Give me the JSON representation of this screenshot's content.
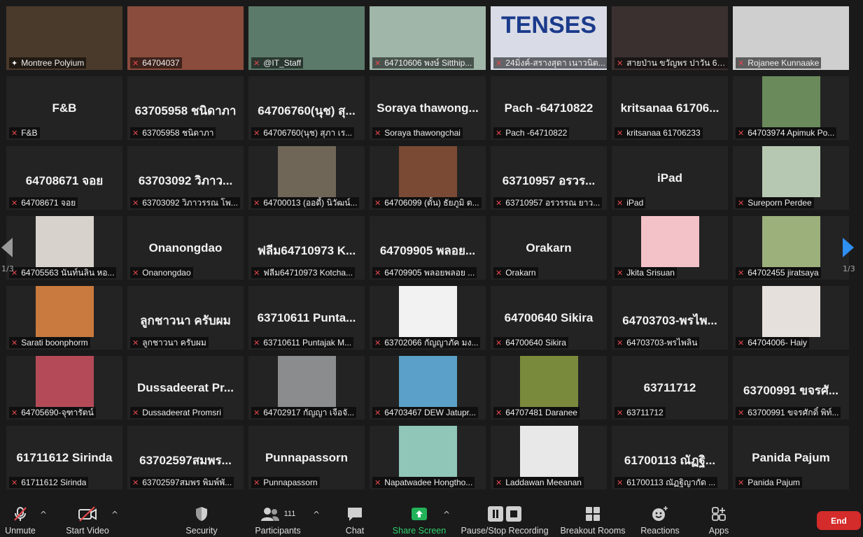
{
  "pagination": {
    "left": "1/3",
    "right": "1/3"
  },
  "tiles": [
    {
      "label": "Montree Polyium",
      "video": true,
      "pin": true,
      "active": true,
      "bg": "#4a3a2c"
    },
    {
      "label": "64704037",
      "video": true,
      "bg": "#8a4c3c"
    },
    {
      "label": "@IT_Staff",
      "video": true,
      "thumb": true,
      "bg": "#5c7a6a"
    },
    {
      "label": "64710606 พงษ์ Sitthip...",
      "video": true,
      "bg": "#9fb6a8"
    },
    {
      "label": "24มิ่งค์-สรางสุดา เนาวนิต...",
      "video": true,
      "bg": "#d9dce6",
      "text_overlay": "TENSES"
    },
    {
      "label": "สายป่าน ขวัญพร ปาวัน 64...",
      "video": true,
      "bg": "#3a3030"
    },
    {
      "label": "Rojanee Kunnaake",
      "video": true,
      "bg": "#cfcfcf"
    },
    {
      "big": "F&B",
      "label": "F&B"
    },
    {
      "big": "63705958 ชนิดาภา",
      "label": "63705958 ชนิดาภา"
    },
    {
      "big": "64706760(นุช) สุ...",
      "label": "64706760(นุช) สุภา เร..."
    },
    {
      "big": "Soraya thawong...",
      "label": "Soraya thawongchai"
    },
    {
      "big": "Pach -64710822",
      "label": "Pach -64710822"
    },
    {
      "big": "kritsanaa 61706...",
      "label": "kritsanaa 61706233"
    },
    {
      "label": "64703974 Apimuk Po...",
      "thumb": true,
      "bg": "#6a8a5c"
    },
    {
      "big": "64708671 จอย",
      "label": "64708671 จอย"
    },
    {
      "big": "63703092 วิภาว...",
      "label": "63703092 วิภาวรรณ โพ..."
    },
    {
      "label": "64700013 (ออดี้) นิวัฒน์...",
      "thumb": true,
      "bg": "#6f6658"
    },
    {
      "label": "64706099 (ตั้น) ธัยภูมิ ต...",
      "thumb": true,
      "bg": "#7a4a34"
    },
    {
      "big": "63710957 อรวร...",
      "label": "63710957 อรวรรณ ยาว..."
    },
    {
      "big": "iPad",
      "label": "iPad"
    },
    {
      "label": "Sureporn Perdee",
      "thumb": true,
      "bg": "#b7c8b2"
    },
    {
      "label": "64705563 นันท์นลิน หอ...",
      "thumb": true,
      "bg": "#d7d2cc"
    },
    {
      "big": "Onanongdao",
      "label": "Onanongdao"
    },
    {
      "big": "ฟลีม64710973 K...",
      "label": "ฟลีม64710973 Kotcha..."
    },
    {
      "big": "64709905 พลอย...",
      "label": "64709905 พลอยพลอย ..."
    },
    {
      "big": "Orakarn",
      "label": "Orakarn"
    },
    {
      "label": "Jkita Srisuan",
      "thumb": true,
      "bg": "#f2c2c8"
    },
    {
      "label": "64702455 jiratsaya",
      "thumb": true,
      "bg": "#9cb07c"
    },
    {
      "label": "Sarati boonphorm",
      "thumb": true,
      "bg": "#c97a3e"
    },
    {
      "big": "ลูกชาวนา ครับผม",
      "label": "ลูกชาวนา ครับผม"
    },
    {
      "big": "63710611 Punta...",
      "label": "63710611 Puntajak M..."
    },
    {
      "label": "63702066 กัญญาภัค มง...",
      "thumb": true,
      "bg": "#f2f2f2"
    },
    {
      "big": "64700640 Sikira",
      "label": "64700640 Sikira"
    },
    {
      "big": "64703703-พรไพ...",
      "label": "64703703-พรไพลิน"
    },
    {
      "label": "64704006- Haiy",
      "thumb": true,
      "bg": "#e6e0dc"
    },
    {
      "label": "64705690-จุฑารัตน์",
      "thumb": true,
      "bg": "#b44a58"
    },
    {
      "big": "Dussadeerat Pr...",
      "label": "Dussadeerat Promsri"
    },
    {
      "label": "64702917 กัญญา เจือจั...",
      "thumb": true,
      "bg": "#8a8c8e"
    },
    {
      "label": "64703467 DEW Jatupr...",
      "thumb": true,
      "bg": "#5aa0c8"
    },
    {
      "label": "64707481 Daranee",
      "thumb": true,
      "bg": "#7a8a3c"
    },
    {
      "big": "63711712",
      "label": "63711712"
    },
    {
      "big": "63700991 ขจรศั...",
      "label": "63700991 ขจรศักดิ์ พิท์..."
    },
    {
      "big": "61711612 Sirinda",
      "label": "61711612 Sirinda"
    },
    {
      "big": "63702597สมพร...",
      "label": "63702597สมพร พิมพ์พั..."
    },
    {
      "big": "Punnapassorn",
      "label": "Punnapassorn"
    },
    {
      "label": "Napatwadee Hongtho...",
      "thumb": true,
      "bg": "#8fc6b8"
    },
    {
      "label": "Laddawan Meeanan",
      "thumb": true,
      "bg": "#e8e8e8"
    },
    {
      "big": "61700113 ณัฏฐิ...",
      "label": "61700113 ณัฏฐิญากัด ..."
    },
    {
      "big": "Panida Pajum",
      "label": "Panida Pajum"
    }
  ],
  "toolbar": {
    "unmute": "Unmute",
    "start_video": "Start Video",
    "security": "Security",
    "participants": "Participants",
    "participants_count": "111",
    "chat": "Chat",
    "share_screen": "Share Screen",
    "recording": "Pause/Stop Recording",
    "breakout": "Breakout Rooms",
    "reactions": "Reactions",
    "apps": "Apps",
    "end": "End"
  }
}
